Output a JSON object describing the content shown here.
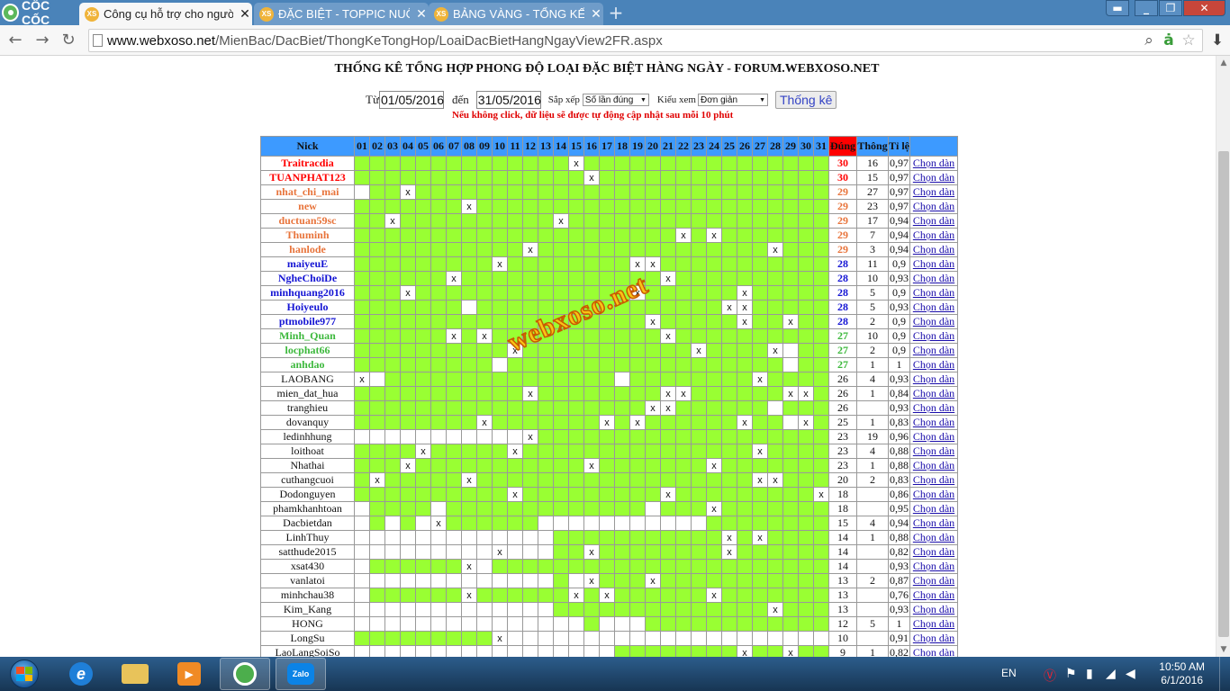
{
  "browser": {
    "tabs": [
      {
        "favicon": "XS",
        "title": "Công cụ hỗ trợ cho người",
        "active": true
      },
      {
        "favicon": "XS",
        "title": "ĐẶC BIỆT - TOPPIC NUÔI Đ",
        "active": false
      },
      {
        "favicon": "XS",
        "title": "BẢNG VÀNG - TỔNG KẾT T",
        "active": false
      }
    ],
    "brand": "CỐC CỐC",
    "url": {
      "host": "www.webxoso.net",
      "path": "/MienBac/DacBiet/ThongKeTongHop/LoaiDacBietHangNgayView2FR.aspx"
    }
  },
  "page": {
    "title": "THỐNG KÊ TỔNG HỢP PHONG ĐỘ LOẠI ĐẶC BIỆT HÀNG NGÀY - FORUM.WEBXOSO.NET",
    "filter": {
      "from_label": "Từ",
      "from_value": "01/05/2016",
      "to_label": "đến",
      "to_value": "31/05/2016",
      "sort_label": "Sắp xếp",
      "sort_value": "Số lần đúng",
      "view_label": "Kiểu xem",
      "view_value": "Đơn giản",
      "submit_label": "Thống kê"
    },
    "notice": "Nếu không click, dữ liệu sẽ được tự động cập nhật sau mỗi 10 phút",
    "watermark": "webxoso.net",
    "colors": {
      "header_bg": "#3d9aff",
      "hit_cell": "#99ff33",
      "dung_header": "#ff0000",
      "red": "#ff0000",
      "orange": "#e8743b",
      "blue": "#1515d4",
      "green": "#3cb83c",
      "link": "#1a0dab"
    }
  },
  "table": {
    "headers": {
      "nick": "Nick",
      "days": [
        "01",
        "02",
        "03",
        "04",
        "05",
        "06",
        "07",
        "08",
        "09",
        "10",
        "11",
        "12",
        "13",
        "14",
        "15",
        "16",
        "17",
        "18",
        "19",
        "20",
        "21",
        "22",
        "23",
        "24",
        "25",
        "26",
        "27",
        "28",
        "29",
        "30",
        "31"
      ],
      "dung": "Đúng",
      "thong": "Thông",
      "tile": "Tỉ lệ"
    },
    "rows": [
      {
        "nick": "Traitracdia",
        "tier": "red",
        "cells": "GGGGGGGGGGGGGGXGGGGGGGGGGGGGGGG",
        "dung": "30",
        "thong": "16",
        "tile": "0,97",
        "action": "Chọn dàn"
      },
      {
        "nick": "TUANPHAT123",
        "tier": "red",
        "cells": "GGGGGGGGGGGGGGGXGGGGGGGGGGGGGGG",
        "dung": "30",
        "thong": "15",
        "tile": "0,97",
        "action": "Chọn dàn"
      },
      {
        "nick": "nhat_chi_mai",
        "tier": "orange",
        "cells": "WGGXGGGGGGGGGGGGGGGGGGGGGGGGGGG",
        "dung": "29",
        "thong": "27",
        "tile": "0,97",
        "action": "Chọn dàn"
      },
      {
        "nick": "new",
        "tier": "orange",
        "cells": "GGGGGGGXGGGGGGGGGGGGGGGGGGGGGGG",
        "dung": "29",
        "thong": "23",
        "tile": "0,97",
        "action": "Chọn dàn"
      },
      {
        "nick": "ductuan59sc",
        "tier": "orange",
        "cells": "GGXGGGGGGGGGGXGGGGGGGGGGGGGGGGG",
        "dung": "29",
        "thong": "17",
        "tile": "0,94",
        "action": "Chọn dàn"
      },
      {
        "nick": "Thuminh",
        "tier": "orange",
        "cells": "GGGGGGGGGGGGGGGGGGGGGXGXGGGGGGG",
        "dung": "29",
        "thong": "7",
        "tile": "0,94",
        "action": "Chọn dàn"
      },
      {
        "nick": "hanlode",
        "tier": "orange",
        "cells": "GGGGGGGGGGGXGGGGGGGGGGGGGGGXGGG",
        "dung": "29",
        "thong": "3",
        "tile": "0,94",
        "action": "Chọn dàn"
      },
      {
        "nick": "maiyeuE",
        "tier": "blue",
        "cells": "GGGGGGGGGXGGGGGGGGXXGGGGGGGGGGG",
        "dung": "28",
        "thong": "11",
        "tile": "0,9",
        "action": "Chọn dàn"
      },
      {
        "nick": "NgheChoiDe",
        "tier": "blue",
        "cells": "GGGGGGXGGGGGGGGGGGGGXGGGGGGGGGG",
        "dung": "28",
        "thong": "10",
        "tile": "0,93",
        "action": "Chọn dàn"
      },
      {
        "nick": "minhquang2016",
        "tier": "blue",
        "cells": "GGGXGGGGGGGGGGGGGGXGGGGGGXGGGGG",
        "dung": "28",
        "thong": "5",
        "tile": "0,9",
        "action": "Chọn dàn"
      },
      {
        "nick": "Hoiyeulo",
        "tier": "blue",
        "cells": "GGGGGGGWGGGGGGGGGGGGGGGGXXGGGGG",
        "dung": "28",
        "thong": "5",
        "tile": "0,93",
        "action": "Chọn dàn"
      },
      {
        "nick": "ptmobile977",
        "tier": "blue",
        "cells": "GGGGGGGGGGGGGGGGGGGXGGGGGXGGXGG",
        "dung": "28",
        "thong": "2",
        "tile": "0,9",
        "action": "Chọn dàn"
      },
      {
        "nick": "Minh_Quan",
        "tier": "green",
        "cells": "GGGGGGXGXGGGGGGGGGGGXGGGGGGGGGG",
        "dung": "27",
        "thong": "10",
        "tile": "0,9",
        "action": "Chọn dàn"
      },
      {
        "nick": "locphat66",
        "tier": "green",
        "cells": "GGGGGGGGGGXGGGGGGGGGGGXGGGGXWGG",
        "dung": "27",
        "thong": "2",
        "tile": "0,9",
        "action": "Chọn dàn"
      },
      {
        "nick": "anhdao",
        "tier": "green",
        "cells": "GGGGGGGGGWGGGGGGGGGGGGGGGGGGWGG",
        "dung": "27",
        "thong": "1",
        "tile": "1",
        "action": "Chọn dàn"
      },
      {
        "nick": "LAOBANG",
        "tier": "plain",
        "cells": "XWGGGGGGGGGGGGGGGWGGGGGGGGXGGGG",
        "dung": "26",
        "thong": "4",
        "tile": "0,93",
        "action": "Chọn dàn"
      },
      {
        "nick": "mien_dat_hua",
        "tier": "plain",
        "cells": "GGGGGGGGGGGXGGGGGGGGXXGGGGGGXXG",
        "dung": "26",
        "thong": "1",
        "tile": "0,84",
        "action": "Chọn dàn"
      },
      {
        "nick": "tranghieu",
        "tier": "plain",
        "cells": "GGGGGGGGGGGGGGGGGGGXXGGGGGGWGGG",
        "dung": "26",
        "thong": "",
        "tile": "0,93",
        "action": "Chọn dàn"
      },
      {
        "nick": "dovanquy",
        "tier": "plain",
        "cells": "GGGGGGGGXGGGGGGGXGXGGGGGGXGGWXG",
        "dung": "25",
        "thong": "1",
        "tile": "0,83",
        "action": "Chọn dàn"
      },
      {
        "nick": "ledinhhung",
        "tier": "plain",
        "cells": "WWWWWWWWWWWXGGGGGGGGGGGGGGGGGGG",
        "dung": "23",
        "thong": "19",
        "tile": "0,96",
        "action": "Chọn dàn"
      },
      {
        "nick": "loithoat",
        "tier": "plain",
        "cells": "GGGGXGGGGGXGGGGGGGGGGGGGGGXGGGG",
        "dung": "23",
        "thong": "4",
        "tile": "0,88",
        "action": "Chọn dàn"
      },
      {
        "nick": "Nhathai",
        "tier": "plain",
        "cells": "GGGXGGGGGGGGGGGXGGGGGGGXGGGGGGG",
        "dung": "23",
        "thong": "1",
        "tile": "0,88",
        "action": "Chọn dàn"
      },
      {
        "nick": "cuthangcuoi",
        "tier": "plain",
        "cells": "GXGGGGGXGGGGGGGGGGGGGGGGGGXXGGG",
        "dung": "20",
        "thong": "2",
        "tile": "0,83",
        "action": "Chọn dàn"
      },
      {
        "nick": "Dodonguyen",
        "tier": "plain",
        "cells": "GGGGGGGGGGXGGGGGGGGGXGGGGGGGGGX",
        "dung": "18",
        "thong": "",
        "tile": "0,86",
        "action": "Chọn dàn"
      },
      {
        "nick": "phamkhanhtoan",
        "tier": "plain",
        "cells": "WGGGGWGGGGGGGGGGGGGWGGGXGGGGGGG",
        "dung": "18",
        "thong": "",
        "tile": "0,95",
        "action": "Chọn dàn"
      },
      {
        "nick": "Dacbietdan",
        "tier": "plain",
        "cells": "WGWGWXGGGGGGWWWWWWWWWWWGGGGGGGG",
        "dung": "15",
        "thong": "4",
        "tile": "0,94",
        "action": "Chọn dàn"
      },
      {
        "nick": "LinhThuy",
        "tier": "plain",
        "cells": "WWWWWWWWWWWWWGGGGGGGGGGGXGXGGGG",
        "dung": "14",
        "thong": "1",
        "tile": "0,88",
        "action": "Chọn dàn"
      },
      {
        "nick": "satthude2015",
        "tier": "plain",
        "cells": "WWWWWWWWWXWWWGGXGGGGGGGGXGGGGGG",
        "dung": "14",
        "thong": "",
        "tile": "0,82",
        "action": "Chọn dàn"
      },
      {
        "nick": "xsat430",
        "tier": "plain",
        "cells": "WGGGGGGXWGGGGGGGGGGGGGGGGGGGGGG",
        "dung": "14",
        "thong": "",
        "tile": "0,93",
        "action": "Chọn dàn"
      },
      {
        "nick": "vanlatoi",
        "tier": "plain",
        "cells": "WWWWWWWWWWWWWGWXGGGXGGGGGGGGGGG",
        "dung": "13",
        "thong": "2",
        "tile": "0,87",
        "action": "Chọn dàn"
      },
      {
        "nick": "minhchau38",
        "tier": "plain",
        "cells": "WGGGGGGXGGGGGGXGXGGGGGGXGGGGGGG",
        "dung": "13",
        "thong": "",
        "tile": "0,76",
        "action": "Chọn dàn"
      },
      {
        "nick": "Kim_Kang",
        "tier": "plain",
        "cells": "WWWWWWWWWWWWWGGGGGGGGGGGGGGXGGG",
        "dung": "13",
        "thong": "",
        "tile": "0,93",
        "action": "Chọn dàn"
      },
      {
        "nick": "HONG",
        "tier": "plain",
        "cells": "WWWWWWWWWWWWWWWGWWWGGGGGGGGGGGG",
        "dung": "12",
        "thong": "5",
        "tile": "1",
        "action": "Chọn dàn"
      },
      {
        "nick": "LongSu",
        "tier": "plain",
        "cells": "GGGGGGGGGXWWWWWWWWWWWWWWWWWWWWW",
        "dung": "10",
        "thong": "",
        "tile": "0,91",
        "action": "Chọn dàn"
      },
      {
        "nick": "LaoLangSoiSo",
        "tier": "plain",
        "cells": "WWWWWWWWWWWWWWWWWGGGGGGGGXGGXGG",
        "dung": "9",
        "thong": "1",
        "tile": "0,82",
        "action": "Chọn dàn"
      }
    ]
  },
  "taskbar": {
    "apps": [
      {
        "name": "Internet Explorer",
        "icon": "ie-icon"
      },
      {
        "name": "File Explorer",
        "icon": "folder-icon"
      },
      {
        "name": "Media Player",
        "icon": "media-icon"
      },
      {
        "name": "Coc Coc",
        "icon": "coccoc-icon"
      },
      {
        "name": "Zalo",
        "icon": "zalo-icon",
        "label": "Zalo"
      }
    ],
    "lang": "EN",
    "time": "10:50 AM",
    "date": "6/1/2016"
  }
}
